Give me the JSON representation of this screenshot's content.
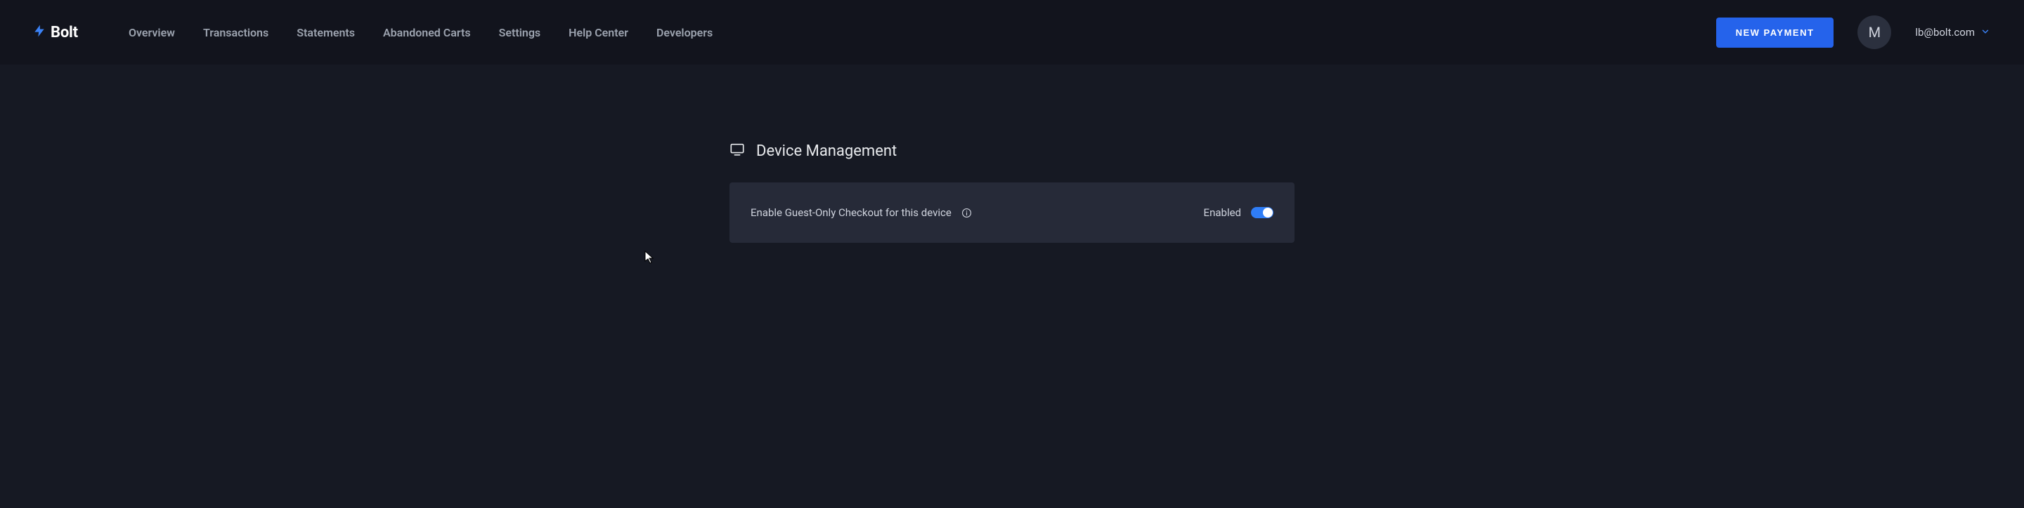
{
  "brand": {
    "name": "Bolt"
  },
  "nav": {
    "items": [
      {
        "label": "Overview"
      },
      {
        "label": "Transactions"
      },
      {
        "label": "Statements"
      },
      {
        "label": "Abandoned Carts"
      },
      {
        "label": "Settings"
      },
      {
        "label": "Help Center"
      },
      {
        "label": "Developers"
      }
    ]
  },
  "header": {
    "new_payment_label": "NEW PAYMENT",
    "avatar_initial": "M",
    "account_email": "lb@bolt.com"
  },
  "section": {
    "title": "Device Management",
    "setting_label": "Enable Guest-Only Checkout for this device",
    "status_text": "Enabled",
    "toggle_on": true
  }
}
